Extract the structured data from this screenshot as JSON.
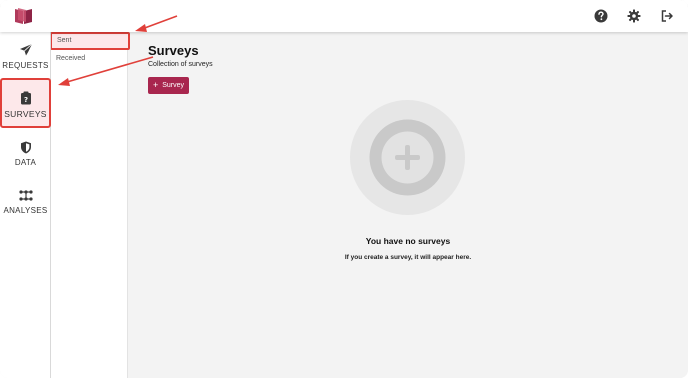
{
  "header": {
    "icons": [
      "book-logo",
      "help-icon",
      "gear-icon",
      "logout-icon"
    ]
  },
  "rail": {
    "items": [
      {
        "label": "REQUESTS",
        "icon": "paper-plane-icon"
      },
      {
        "label": "SURVEYS",
        "icon": "clipboard-icon",
        "active": true
      },
      {
        "label": "DATA",
        "icon": "shield-icon"
      },
      {
        "label": "ANALYSES",
        "icon": "network-icon"
      }
    ]
  },
  "subnav": {
    "items": [
      {
        "label": "Sent",
        "active": true
      },
      {
        "label": "Received"
      }
    ]
  },
  "main": {
    "title": "Surveys",
    "subtitle": "Collection of surveys",
    "add_button": {
      "plus": "+",
      "label": "Survey"
    },
    "empty": {
      "title": "You have no surveys",
      "description": "If you create a survey, it will appear here."
    }
  },
  "colors": {
    "accent": "#a8264e",
    "highlight_border": "#e0403a",
    "highlight_fill": "#fde8ea",
    "background": "#f3f3f3"
  }
}
